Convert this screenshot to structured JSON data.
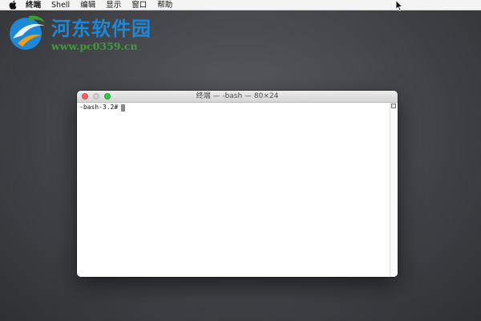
{
  "menubar": {
    "apple_icon": "apple-logo-icon",
    "items": [
      "终端",
      "Shell",
      "编辑",
      "显示",
      "窗口",
      "帮助"
    ]
  },
  "watermark": {
    "site_name": "河东软件园",
    "url": "www.pc0359.cn",
    "colors": {
      "title": "#1c88d8",
      "url": "#3e9d3a"
    }
  },
  "terminal": {
    "title": "终端 — -bash — 80×24",
    "prompt": "-bash-3.2#",
    "traffic_lights": [
      "close",
      "minimize",
      "zoom"
    ],
    "colors": {
      "close": "#fc605c",
      "minimize": "#d0d0d0",
      "zoom": "#34c84a"
    }
  }
}
